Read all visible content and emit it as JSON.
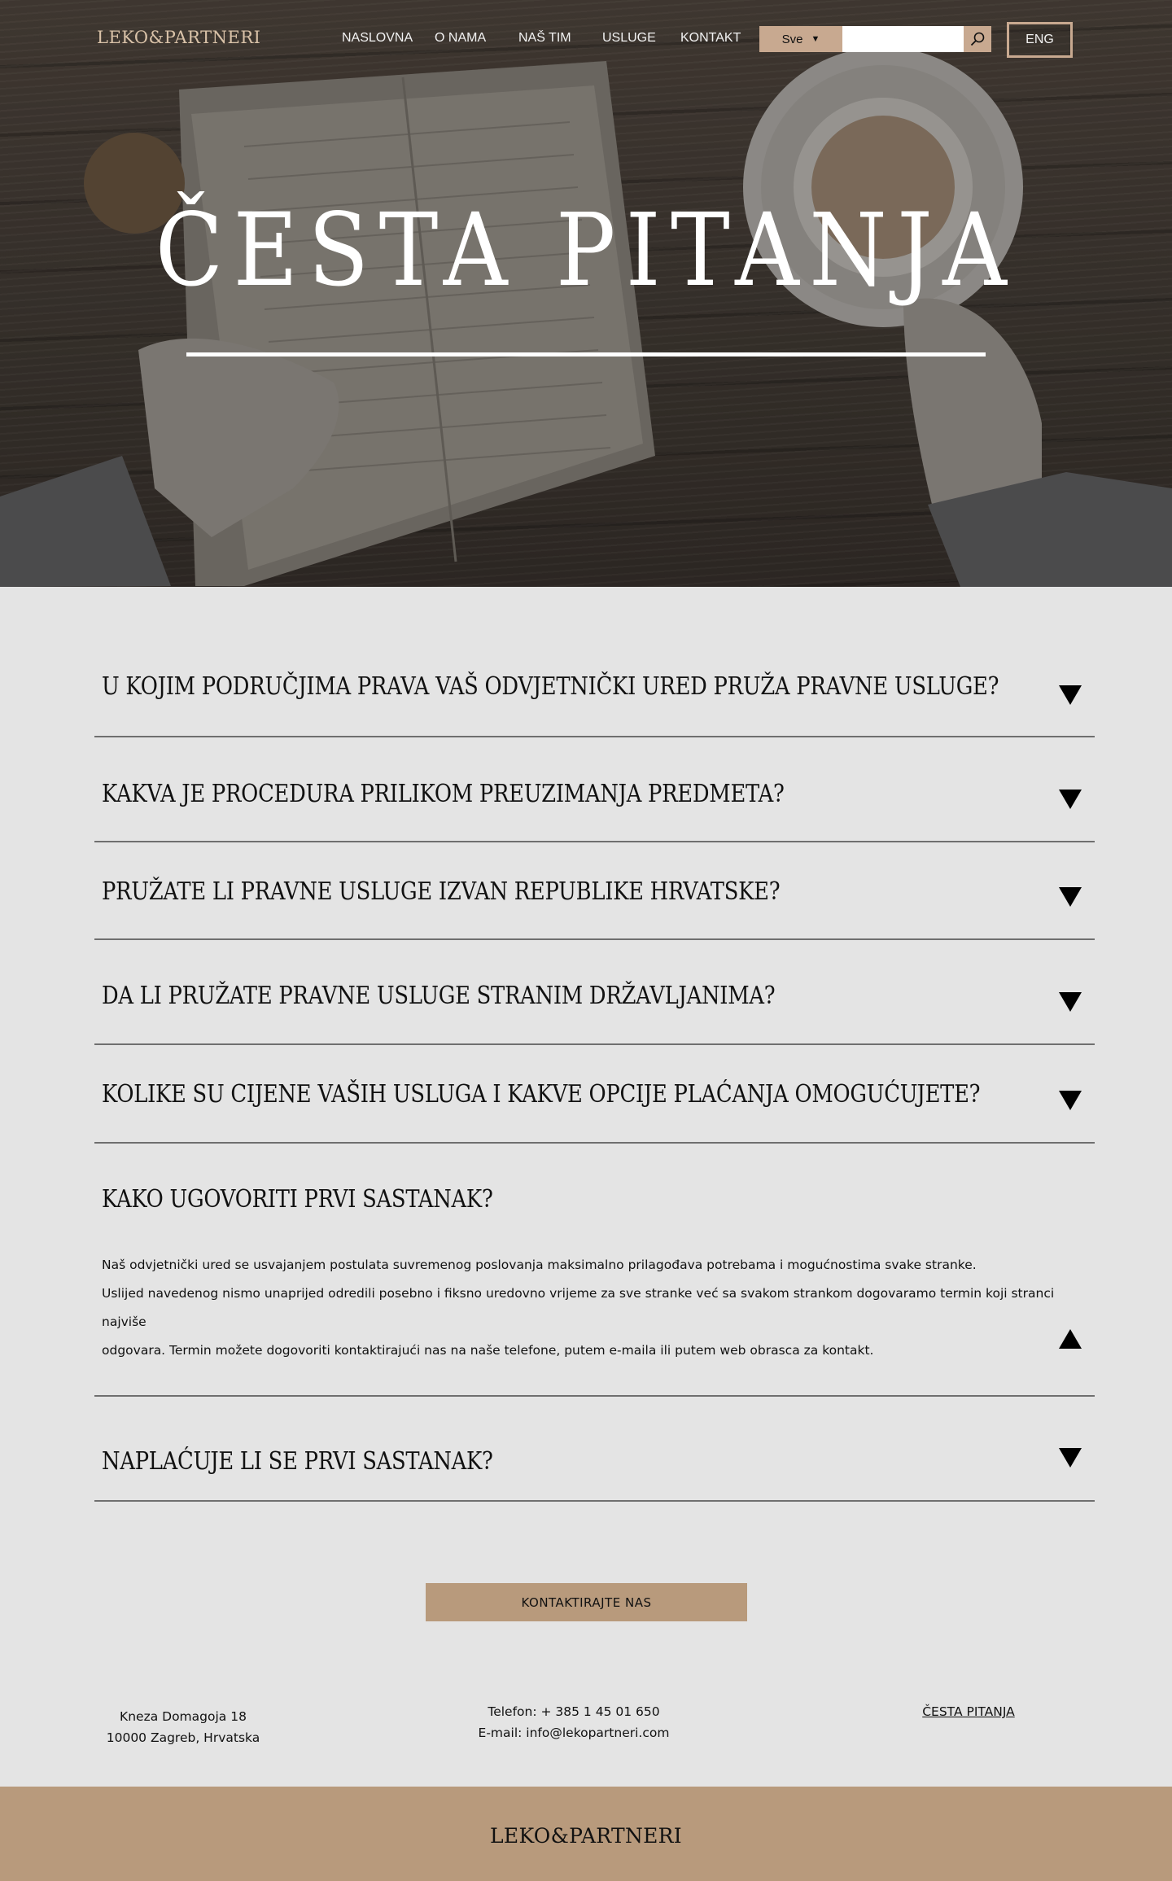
{
  "brand": {
    "logo_text": "LEKO&PARTNERI"
  },
  "nav": {
    "items": [
      {
        "label": "NASLOVNA"
      },
      {
        "label": "O NAMA"
      },
      {
        "label": "NAŠ TIM"
      },
      {
        "label": "USLUGE"
      },
      {
        "label": "KONTAKT"
      }
    ],
    "search": {
      "scope_selected": "Sve",
      "value": "",
      "icon": "search-icon"
    },
    "language_button": "ENG"
  },
  "hero": {
    "title": "ČESTA PITANJA"
  },
  "faq": [
    {
      "question": "U KOJIM PODRUČJIMA PRAVA VAŠ ODVJETNIČKI URED PRUŽA PRAVNE USLUGE?",
      "expanded": false
    },
    {
      "question": "KAKVA JE PROCEDURA PRILIKOM PREUZIMANJA PREDMETA?",
      "expanded": false
    },
    {
      "question": "PRUŽATE LI PRAVNE USLUGE IZVAN REPUBLIKE HRVATSKE?",
      "expanded": false
    },
    {
      "question": "DA LI PRUŽATE PRAVNE USLUGE STRANIM DRŽAVLJANIMA?",
      "expanded": false
    },
    {
      "question": "KOLIKE SU CIJENE VAŠIH USLUGA I KAKVE OPCIJE PLAĆANJA OMOGUĆUJETE?",
      "expanded": false
    },
    {
      "question": "KAKO UGOVORITI PRVI SASTANAK?",
      "expanded": true,
      "answer_lines": [
        "Naš odvjetnički ured se usvajanjem postulata suvremenog poslovanja maksimalno prilagođava potrebama i mogućnostima svake stranke.",
        "Uslijed navedenog nismo unaprijed odredili posebno i fiksno uredovno vrijeme za sve stranke već sa svakom strankom dogovaramo termin koji stranci najviše",
        "odgovara. Termin možete dogovoriti kontaktirajući nas na naše telefone, putem e-maila ili putem web obrasca za kontakt."
      ]
    },
    {
      "question": "NAPLAĆUJE LI SE PRVI SASTANAK?",
      "expanded": false
    }
  ],
  "cta": {
    "label": "KONTAKTIRAJTE NAS"
  },
  "footer": {
    "address": [
      "Kneza Domagoja 18",
      "10000 Zagreb, Hrvatska"
    ],
    "contact": [
      "Telefon: + 385 1 45 01 650",
      "E-mail: info@lekopartneri.com"
    ],
    "link": "ČESTA PITANJA",
    "band_logo": "LEKO&PARTNERI"
  },
  "colors": {
    "accent": "#b89a7c",
    "accent_light": "#c8a990",
    "page_background": "#e4e4e4",
    "text": "#111111"
  }
}
